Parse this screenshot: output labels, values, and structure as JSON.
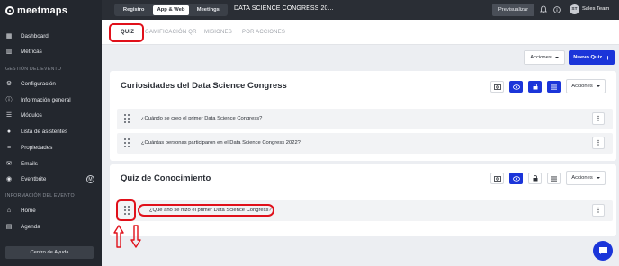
{
  "brand": {
    "logo_text": "meetmaps",
    "accent": "#1b35d9",
    "highlight": "#e0101a"
  },
  "sidebar": {
    "items_top": [
      {
        "label": "Dashboard",
        "icon": "grid-icon"
      },
      {
        "label": "Métricas",
        "icon": "chart-icon"
      }
    ],
    "section_event": "GESTIÓN DEL EVENTO",
    "items_event": [
      {
        "label": "Configuración",
        "icon": "gear-icon"
      },
      {
        "label": "Información general",
        "icon": "info-icon"
      },
      {
        "label": "Módulos",
        "icon": "list-icon"
      },
      {
        "label": "Lista de asistentes",
        "icon": "users-icon"
      },
      {
        "label": "Propiedades",
        "icon": "tags-icon"
      },
      {
        "label": "Emails",
        "icon": "mail-icon"
      },
      {
        "label": "Eventbrite",
        "icon": "eventbrite-icon",
        "badge": "M"
      }
    ],
    "section_info": "INFORMACIÓN DEL EVENTO",
    "items_info": [
      {
        "label": "Home",
        "icon": "home-icon"
      },
      {
        "label": "Agenda",
        "icon": "calendar-icon"
      }
    ],
    "help_label": "Centro de Ayuda"
  },
  "topbar": {
    "tabs": [
      "Registro",
      "App & Web",
      "Meetings"
    ],
    "active_tab": "App & Web",
    "event_title": "DATA SCIENCE CONGRESS 20...",
    "preview_label": "Previsualizar",
    "user_initials": "ST",
    "user_name": "Sales Team"
  },
  "subtabs": {
    "items": [
      "QUIZ",
      "GAMIFICACIÓN QR",
      "MISIONES",
      "POR ACCIONES"
    ],
    "active": "QUIZ"
  },
  "toolbar": {
    "actions_label": "Acciones",
    "new_quiz_label": "Nuevo Quiz",
    "new_quiz_icon": "+"
  },
  "quizzes": [
    {
      "title": "Curiosidades del Data Science Congress",
      "actions_label": "Acciones",
      "questions": [
        "¿Cuándo se creo el primer Data Science Congress?",
        "¿Cuántas personas participaron en el Data Science Congress 2022?"
      ]
    },
    {
      "title": "Quiz de Conocimiento",
      "actions_label": "Acciones",
      "questions": [
        "¿Qué año se hizo el primer Data Science Congress?"
      ]
    }
  ]
}
